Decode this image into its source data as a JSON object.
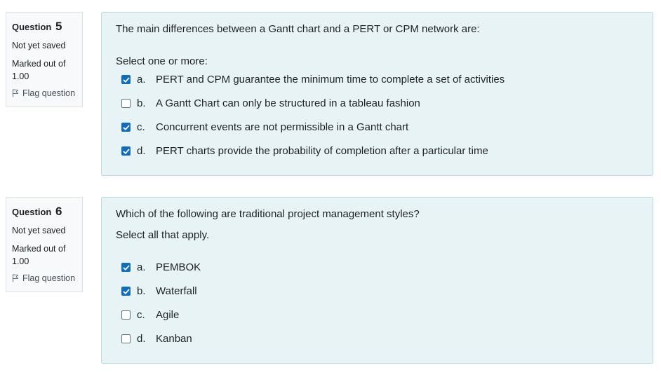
{
  "questions": [
    {
      "label": "Question",
      "number": "5",
      "state": "Not yet saved",
      "grade_line1": "Marked out of",
      "grade_line2": "1.00",
      "flag_label": "Flag question",
      "text": "The main differences between a Gantt chart and a PERT or CPM network are:",
      "prompt": "Select one or more:",
      "options": [
        {
          "letter": "a.",
          "text": "PERT and CPM guarantee the minimum time to complete a set of activities",
          "checked": true
        },
        {
          "letter": "b.",
          "text": "A Gantt Chart can only be structured in a tableau fashion",
          "checked": false
        },
        {
          "letter": "c.",
          "text": "Concurrent events are not permissible in a Gantt chart",
          "checked": true
        },
        {
          "letter": "d.",
          "text": "PERT charts provide the probability of completion after a particular time",
          "checked": true
        }
      ]
    },
    {
      "label": "Question",
      "number": "6",
      "state": "Not yet saved",
      "grade_line1": "Marked out of",
      "grade_line2": "1.00",
      "flag_label": "Flag question",
      "text": "Which of the following are traditional project management styles?",
      "prompt": "Select all that apply.",
      "options": [
        {
          "letter": "a.",
          "text": "PEMBOK",
          "checked": true
        },
        {
          "letter": "b.",
          "text": "Waterfall",
          "checked": true
        },
        {
          "letter": "c.",
          "text": "Agile",
          "checked": false
        },
        {
          "letter": "d.",
          "text": "Kanban",
          "checked": false
        }
      ]
    }
  ],
  "colors": {
    "checkbox_checked": "#0f6cbf",
    "content_background": "#e7f3f5",
    "info_background": "#f8f9fa"
  }
}
